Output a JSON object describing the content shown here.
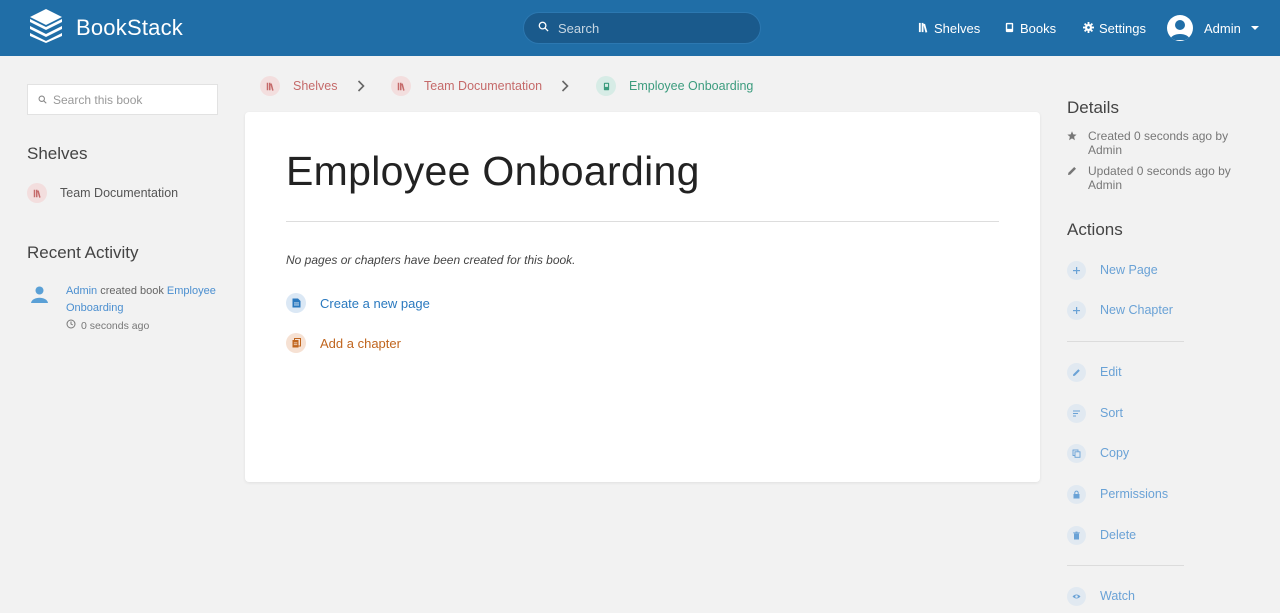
{
  "header": {
    "app_name": "BookStack",
    "search_placeholder": "Search",
    "nav": {
      "shelves": "Shelves",
      "books": "Books",
      "settings": "Settings"
    },
    "user_name": "Admin"
  },
  "left_sidebar": {
    "search_placeholder": "Search this book",
    "shelves_heading": "Shelves",
    "shelves": [
      {
        "label": "Team Documentation"
      }
    ],
    "recent_activity_heading": "Recent Activity",
    "activity": {
      "user": "Admin",
      "action": "created book",
      "target_line1": "Employee",
      "target_line2": "Onboarding",
      "time": "0 seconds ago"
    }
  },
  "breadcrumbs": [
    {
      "label": "Shelves"
    },
    {
      "label": "Team Documentation"
    },
    {
      "label": "Employee Onboarding"
    }
  ],
  "main": {
    "title": "Employee Onboarding",
    "empty_message": "No pages or chapters have been created for this book.",
    "create_page_label": "Create a new page",
    "add_chapter_label": "Add a chapter"
  },
  "right_sidebar": {
    "details_heading": "Details",
    "created_line1": "Created 0 seconds ago by",
    "created_line2": "Admin",
    "updated_line1": "Updated 0 seconds ago by",
    "updated_line2": "Admin",
    "actions_heading": "Actions",
    "actions": {
      "new_page": "New Page",
      "new_chapter": "New Chapter",
      "edit": "Edit",
      "sort": "Sort",
      "copy": "Copy",
      "permissions": "Permissions",
      "delete": "Delete",
      "watch": "Watch"
    }
  },
  "colors": {
    "header": "#206ea7",
    "shelf": "#c56a6a",
    "book": "#3c9c7e",
    "page": "#2a79bf",
    "chapter": "#c0651e",
    "action": "#6aa2d6"
  }
}
